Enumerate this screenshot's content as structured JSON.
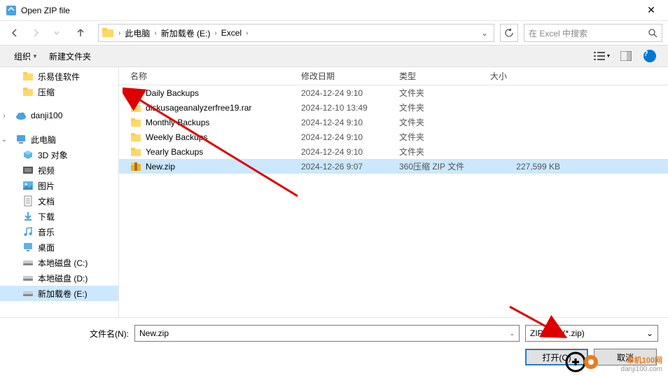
{
  "title": "Open ZIP file",
  "breadcrumb": {
    "p1": "此电脑",
    "p2": "新加载卷 (E:)",
    "p3": "Excel"
  },
  "search_placeholder": "在 Excel 中搜索",
  "toolbar": {
    "organize": "组织",
    "newfolder": "新建文件夹"
  },
  "columns": {
    "name": "名称",
    "date": "修改日期",
    "type": "类型",
    "size": "大小"
  },
  "sidebar": {
    "items1": [
      {
        "label": "乐易佳软件"
      },
      {
        "label": "压缩"
      }
    ],
    "danji": "danji100",
    "pc": "此电脑",
    "pcitems": [
      {
        "label": "3D 对象"
      },
      {
        "label": "视频"
      },
      {
        "label": "图片"
      },
      {
        "label": "文档"
      },
      {
        "label": "下载"
      },
      {
        "label": "音乐"
      },
      {
        "label": "桌面"
      },
      {
        "label": "本地磁盘 (C:)"
      },
      {
        "label": "本地磁盘 (D:)"
      },
      {
        "label": "新加载卷 (E:)"
      }
    ]
  },
  "files": [
    {
      "name": "Daily Backups",
      "date": "2024-12-24 9:10",
      "type": "文件夹",
      "size": "",
      "kind": "folder"
    },
    {
      "name": "diskusageanalyzerfree19.rar",
      "date": "2024-12-10 13:49",
      "type": "文件夹",
      "size": "",
      "kind": "folder"
    },
    {
      "name": "Monthly Backups",
      "date": "2024-12-24 9:10",
      "type": "文件夹",
      "size": "",
      "kind": "folder"
    },
    {
      "name": "Weekly Backups",
      "date": "2024-12-24 9:10",
      "type": "文件夹",
      "size": "",
      "kind": "folder"
    },
    {
      "name": "Yearly Backups",
      "date": "2024-12-24 9:10",
      "type": "文件夹",
      "size": "",
      "kind": "folder"
    },
    {
      "name": "New.zip",
      "date": "2024-12-26 9:07",
      "type": "360压缩 ZIP 文件",
      "size": "227,599 KB",
      "kind": "zip",
      "selected": true
    }
  ],
  "filename_label": "文件名(N):",
  "filename_value": "New.zip",
  "filter": "ZIP files (*.zip)",
  "buttons": {
    "open": "打开(O)",
    "cancel": "取消"
  },
  "watermark": {
    "l1": "单机100网",
    "l2": "danji100.com"
  }
}
